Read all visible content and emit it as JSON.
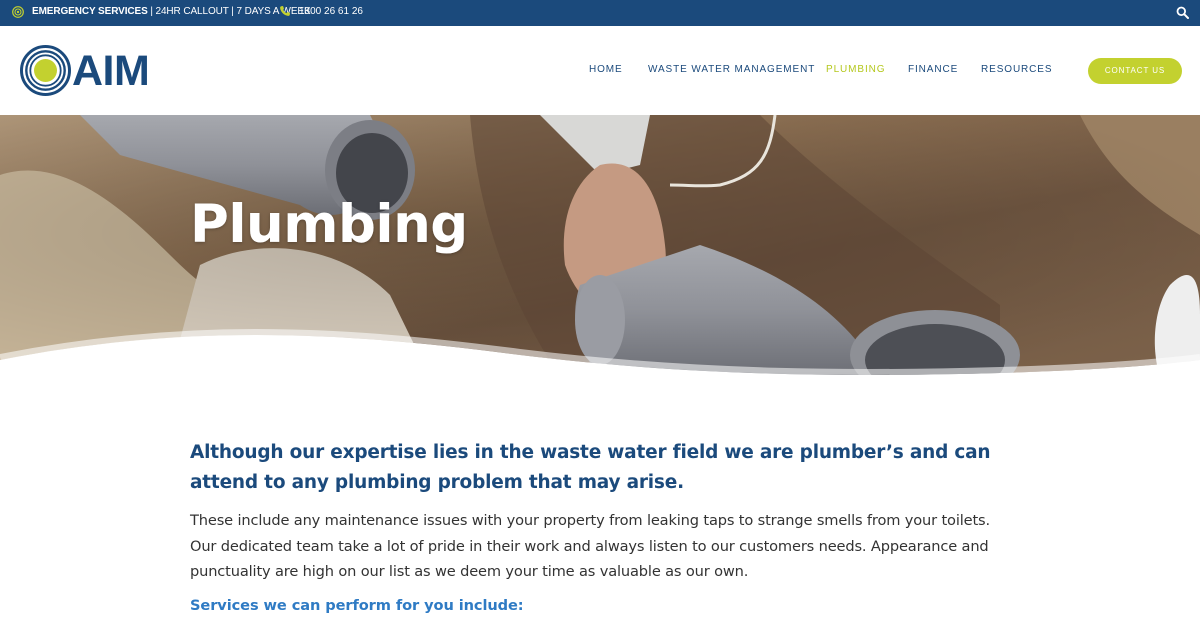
{
  "topbar": {
    "emergency_label": "EMERGENCY SERVICES",
    "callout_text": " | 24HR CALLOUT | 7 DAYS A WEEK",
    "phone": "1300 26 61 26",
    "icons": [
      "target-icon",
      "phone-icon",
      "search-icon"
    ]
  },
  "logo": {
    "text": "AIM"
  },
  "nav": {
    "items": [
      {
        "label": "HOME",
        "active": false
      },
      {
        "label": "WASTE WATER MANAGEMENT",
        "active": false
      },
      {
        "label": "PLUMBING",
        "active": true
      },
      {
        "label": "FINANCE",
        "active": false
      },
      {
        "label": "RESOURCES",
        "active": false
      }
    ],
    "contact_label": "CONTACT US"
  },
  "hero": {
    "title": "Plumbing"
  },
  "content": {
    "intro": "Although our expertise lies in the waste water field we are plumber’s and can attend to any plumbing problem that may arise.",
    "body": "These include any maintenance issues with your property from leaking taps to strange smells from your toilets. Our dedicated team take a lot of pride in their work and always listen to our customers needs. Appearance and punctuality are high on our list as we deem your time as valuable as our own.",
    "services_heading": "Services we can perform for you include:"
  },
  "colors": {
    "brand_blue": "#1b4a7c",
    "accent_green": "#c3d12f",
    "link_blue": "#2f7bc4"
  }
}
